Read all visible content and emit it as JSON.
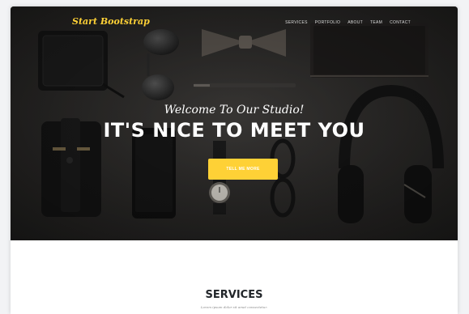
{
  "navbar": {
    "brand": "Start Bootstrap",
    "links": [
      "SERVICES",
      "PORTFOLIO",
      "ABOUT",
      "TEAM",
      "CONTACT"
    ]
  },
  "hero": {
    "subheading": "Welcome To Our Studio!",
    "heading": "IT'S NICE TO MEET YOU",
    "cta_label": "TELL ME MORE"
  },
  "services": {
    "title": "SERVICES",
    "subtitle": "Lorem ipsum dolor sit amet consectetur."
  },
  "colors": {
    "accent": "#fed136",
    "hero_dark": "#2b2b2b",
    "page_bg": "#ffffff"
  },
  "icons": {
    "wallet": "wallet-icon",
    "sunglasses": "sunglasses-icon",
    "bow_tie": "bowtie-icon",
    "notebook": "notebook-icon",
    "pen": "pen-icon",
    "headphones": "headphones-icon",
    "phone": "phone-icon",
    "watch": "watch-icon",
    "glasses": "glasses-icon",
    "pouch": "pouch-icon"
  }
}
